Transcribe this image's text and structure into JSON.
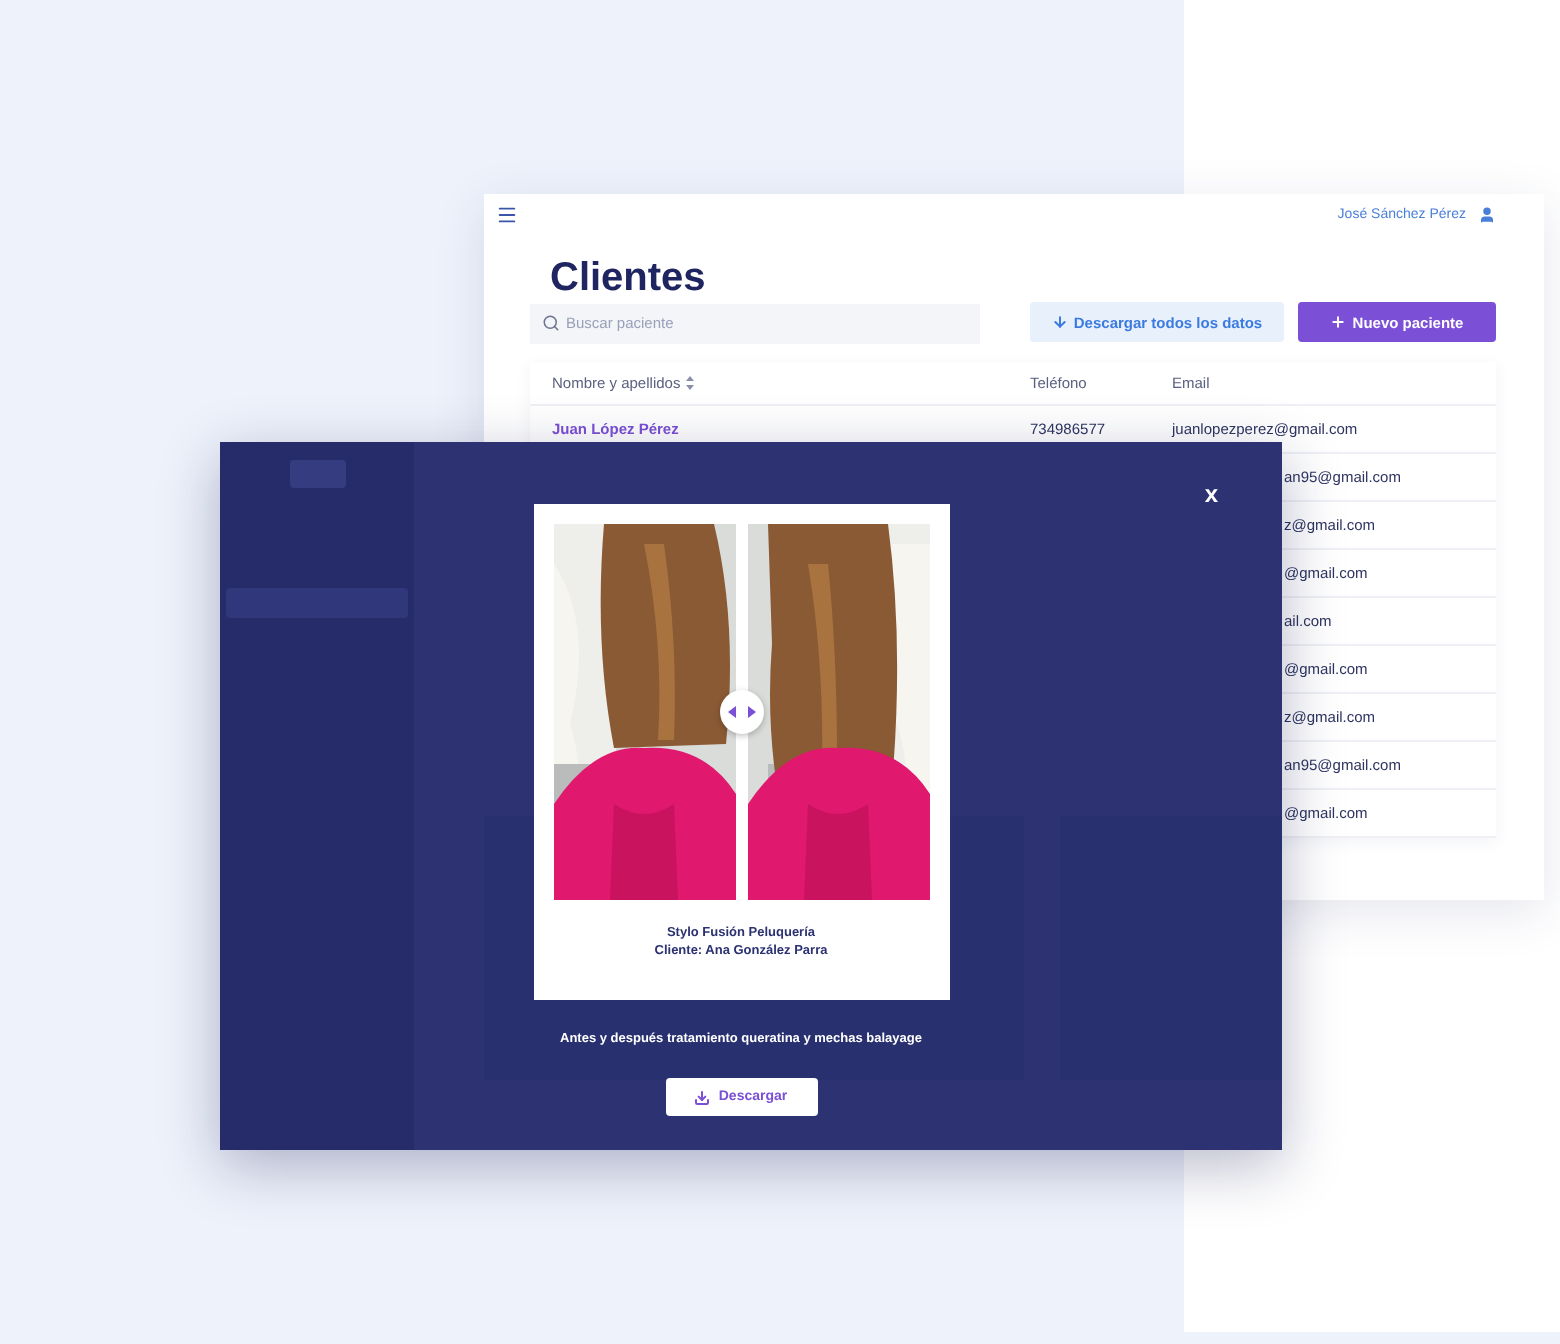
{
  "clients_window": {
    "user_name": "José Sánchez Pérez",
    "title": "Clientes",
    "search": {
      "placeholder": "Buscar paciente"
    },
    "buttons": [
      {
        "kind": "secondary",
        "label": "Descargar todos los datos"
      },
      {
        "kind": "primary",
        "label": "Nuevo paciente"
      }
    ],
    "table": {
      "columns": [
        "Nombre y apellidos",
        "Teléfono",
        "Email"
      ],
      "rows": [
        {
          "kind": "full",
          "name": "Juan López Pérez",
          "phone": "734986577",
          "email": "juanlopezperez@gmail.com"
        },
        {
          "kind": "covered",
          "email": "an95@gmail.com"
        },
        {
          "kind": "covered",
          "email": "z@gmail.com"
        },
        {
          "kind": "covered",
          "email": "@gmail.com"
        },
        {
          "kind": "covered",
          "email": "ail.com"
        },
        {
          "kind": "covered",
          "email": "@gmail.com"
        },
        {
          "kind": "covered",
          "email": "z@gmail.com"
        },
        {
          "kind": "covered",
          "email": "an95@gmail.com"
        },
        {
          "kind": "covered",
          "email": "@gmail.com"
        }
      ]
    }
  },
  "photo_modal": {
    "close": "x",
    "studio": "Stylo Fusión Peluquería",
    "client": "Cliente: Ana González Parra",
    "description": "Antes y después tratamiento queratina y mechas balayage",
    "download_label": "Descargar"
  }
}
